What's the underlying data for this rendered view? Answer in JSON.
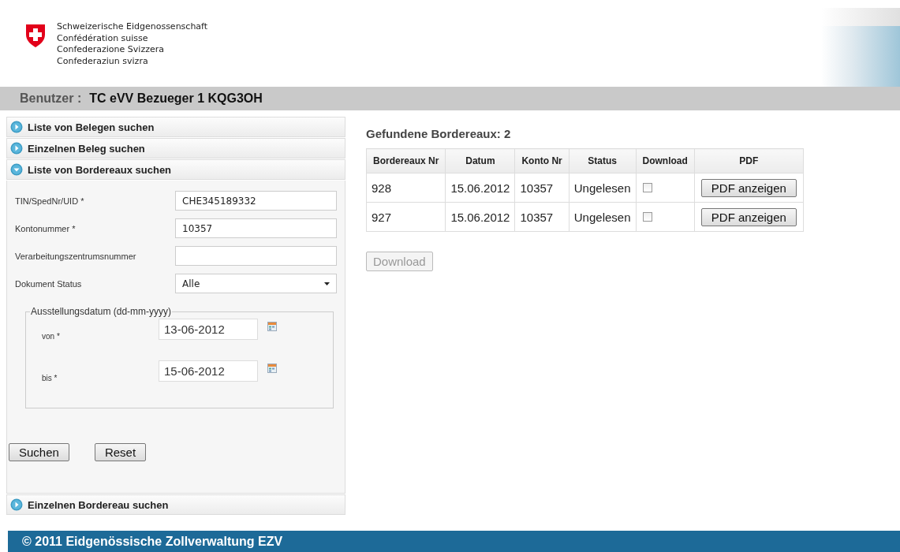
{
  "header": {
    "org_lines": [
      "Schweizerische Eidgenossenschaft",
      "Confédération suisse",
      "Confederazione Svizzera",
      "Confederaziun svizra"
    ]
  },
  "user_bar": {
    "label": "Benutzer :",
    "name": "TC eVV Bezueger 1 KQG3OH"
  },
  "accordion": [
    {
      "label": "Liste von Belegen suchen",
      "expanded": false
    },
    {
      "label": "Einzelnen Beleg suchen",
      "expanded": false
    },
    {
      "label": "Liste von Bordereaux suchen",
      "expanded": true
    },
    {
      "label": "Einzelnen Bordereau suchen",
      "expanded": false
    }
  ],
  "form": {
    "fields": [
      {
        "kind": "text",
        "label": "TIN/SpedNr/UID *",
        "value": "CHE345189332"
      },
      {
        "kind": "text",
        "label": "Kontonummer *",
        "value": "10357"
      },
      {
        "kind": "text",
        "label": "Verarbeitungszentrumsnummer"
      },
      {
        "kind": "select",
        "label": "Dokument Status",
        "value": "Alle"
      }
    ],
    "date_group": {
      "legend": "Ausstellungsdatum (dd-mm-yyyy)",
      "fields": [
        {
          "label": "von *",
          "value": "13-06-2012"
        },
        {
          "label": "bis *",
          "value": "15-06-2012"
        }
      ]
    },
    "buttons": [
      "Suchen",
      "Reset"
    ]
  },
  "results": {
    "title": "Gefundene Bordereaux: 2",
    "columns": [
      "Bordereaux Nr",
      "Datum",
      "Konto Nr",
      "Status",
      "Download",
      "PDF"
    ],
    "rows": [
      {
        "number": "928",
        "date": "15.06.2012",
        "account": "10357",
        "status": "Ungelesen",
        "checked": false,
        "button": "PDF anzeigen"
      },
      {
        "number": "927",
        "date": "15.06.2012",
        "account": "10357",
        "status": "Ungelesen",
        "checked": false,
        "button": "PDF anzeigen"
      }
    ],
    "download_button": {
      "label": "Download",
      "disabled": true
    }
  },
  "footer": {
    "text": "© 2011 Eidgenössische Zollverwaltung EZV"
  }
}
